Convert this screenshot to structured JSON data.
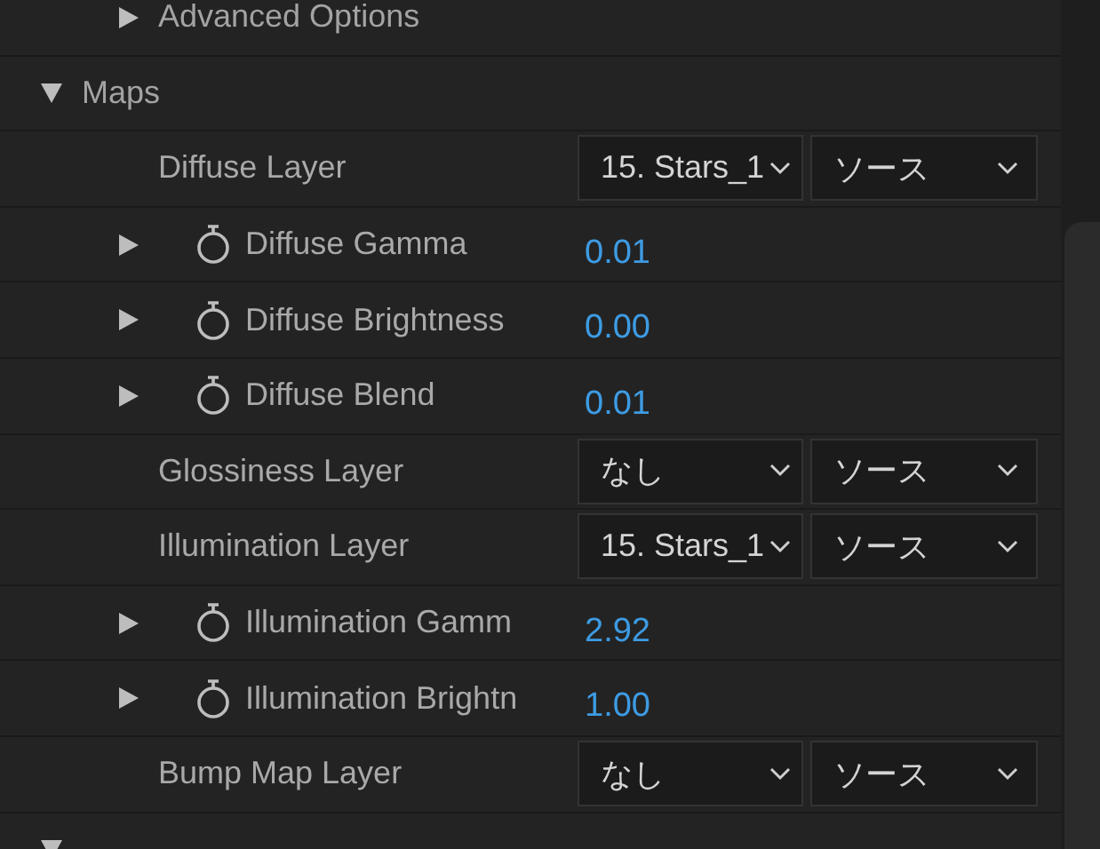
{
  "properties": [
    {
      "kind": "container",
      "children": [
        {
          "kind": "group",
          "label": "Advanced Options",
          "expanded": false
        }
      ]
    },
    {
      "kind": "group",
      "label": "Maps",
      "expanded": true,
      "children": [
        {
          "kind": "layer",
          "label": "Diffuse Layer",
          "layer": "15. Stars_1",
          "channel": "ソース"
        },
        {
          "kind": "param",
          "label": "Diffuse Gamma",
          "value": "0.01",
          "expanded": false
        },
        {
          "kind": "param",
          "label": "Diffuse Brightness",
          "value": "0.00",
          "expanded": false
        },
        {
          "kind": "param",
          "label": "Diffuse Blend",
          "value": "0.01",
          "expanded": false
        },
        {
          "kind": "layer",
          "label": "Glossiness Layer",
          "layer": "なし",
          "channel": "ソース"
        },
        {
          "kind": "layer",
          "label": "Illumination Layer",
          "layer": "15. Stars_1",
          "channel": "ソース"
        },
        {
          "kind": "param",
          "label": "Illumination Gamm",
          "value": "2.92",
          "expanded": false
        },
        {
          "kind": "param",
          "label": "Illumination Brightn",
          "value": "1.00",
          "expanded": false
        },
        {
          "kind": "layer",
          "label": "Bump Map Layer",
          "layer": "なし",
          "channel": "ソース"
        }
      ]
    },
    {
      "kind": "group",
      "expanded": true
    }
  ]
}
